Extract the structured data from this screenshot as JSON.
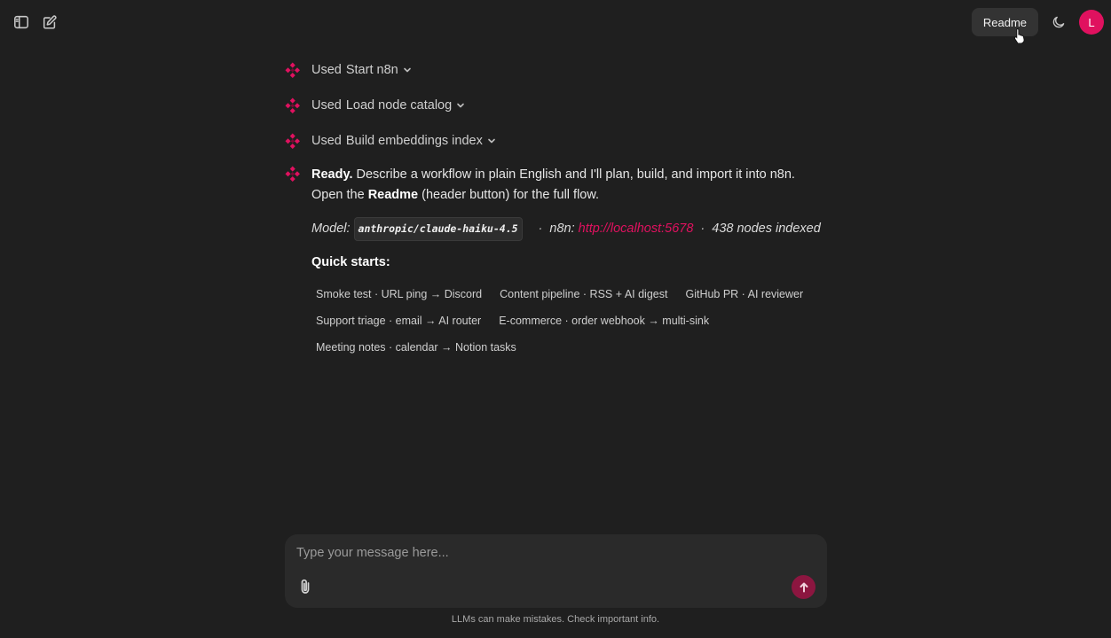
{
  "header": {
    "readme_label": "Readme",
    "avatar_initial": "L",
    "icons": [
      "sidebar-toggle-icon",
      "new-chat-icon",
      "moon-icon"
    ]
  },
  "tools": [
    {
      "prefix": "Used",
      "name": "Start n8n"
    },
    {
      "prefix": "Used",
      "name": "Load node catalog"
    },
    {
      "prefix": "Used",
      "name": "Build embeddings index"
    }
  ],
  "message": {
    "ready": "Ready.",
    "line1": "Describe a workflow in plain English and I'll plan, build, and import it into n8n. Open the",
    "readme": "Readme",
    "line2": "(header button) for the full flow.",
    "model_label": "Model:",
    "model_value": "anthropic/claude-haiku-4.5",
    "n8n_label": "n8n:",
    "n8n_url": "http://localhost:5678",
    "nodes_indexed": "438 nodes indexed",
    "sep": "·",
    "quick_starts_title": "Quick starts:",
    "quick_starts": [
      "Smoke test · URL ping → Discord",
      "Content pipeline · RSS + AI digest",
      "GitHub PR · AI reviewer",
      "Support triage · email → AI router",
      "E-commerce · order webhook → multi-sink",
      "Meeting notes · calendar → Notion tasks"
    ]
  },
  "composer": {
    "placeholder": "Type your message here..."
  },
  "footer": {
    "disclaimer": "LLMs can make mistakes. Check important info."
  },
  "colors": {
    "background": "#1f1f1f",
    "accent": "#e0115f",
    "send_button": "#8c1640",
    "composer_bg": "#2a2a2a"
  }
}
